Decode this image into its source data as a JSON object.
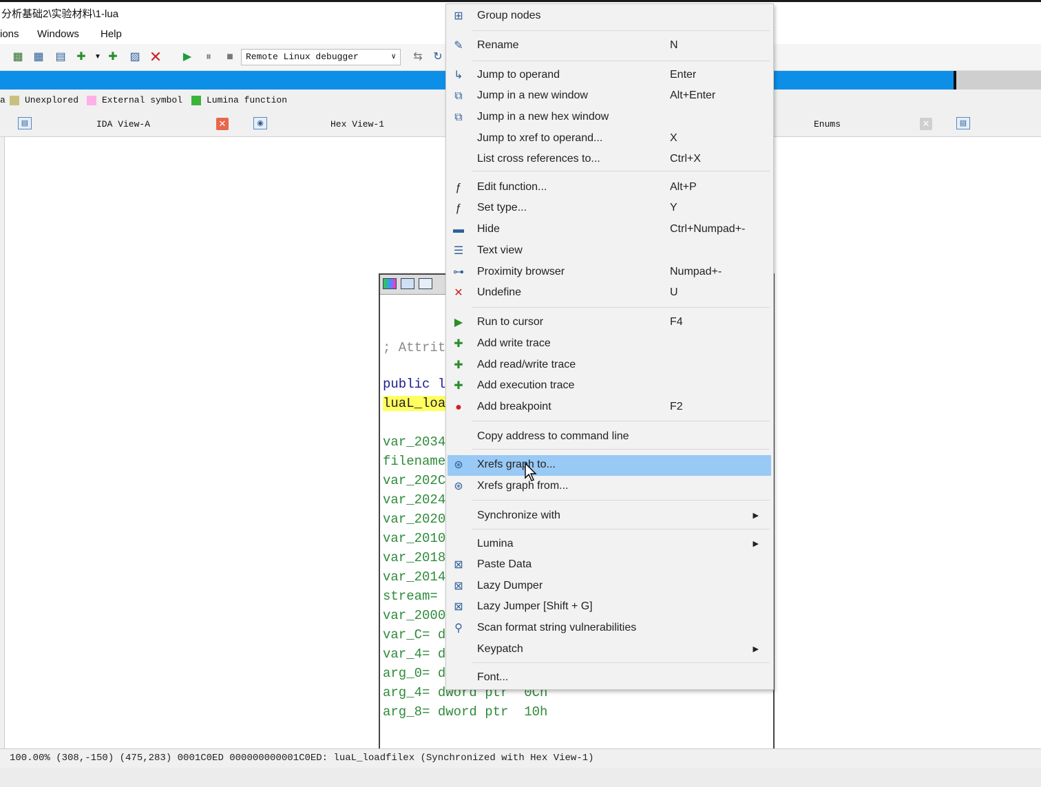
{
  "window": {
    "title": "分析基础2\\实验材料\\1-lua"
  },
  "menubar": {
    "items": [
      "ions",
      "Windows",
      "Help"
    ]
  },
  "toolbar": {
    "debugger": "Remote Linux debugger",
    "icons": [
      "new-seg-icon",
      "edit-seg-icon",
      "struct-icon",
      "bookmark-icon",
      "jump-icon",
      "rename-icon",
      "delete-icon",
      "play-icon",
      "pause-icon",
      "stop-icon",
      "debug-opt-icon",
      "refresh-icon"
    ]
  },
  "legend": {
    "items": [
      {
        "label": "Unexplored",
        "color": "#c8c080"
      },
      {
        "label": "External symbol",
        "color": "#ffb0e8"
      },
      {
        "label": "Lumina function",
        "color": "#3cb43c"
      }
    ],
    "prefix": "a"
  },
  "tabs": [
    {
      "label": "IDA View-A"
    },
    {
      "label": "Hex View-1"
    },
    {
      "label": "Enums"
    }
  ],
  "code": {
    "lines": [
      {
        "text": "; Attrit",
        "cls": "c-grey"
      },
      {
        "text": "public l",
        "cls": "c-navy"
      },
      {
        "text": "luaL_loa",
        "cls": "c-black hl"
      },
      {
        "text": "var_2034",
        "cls": "c-green"
      },
      {
        "text": "filename",
        "cls": "c-green"
      },
      {
        "text": "var_202C",
        "cls": "c-green"
      },
      {
        "text": "var_2024",
        "cls": "c-green"
      },
      {
        "text": "var_2020",
        "cls": "c-green"
      },
      {
        "text": "var_2010",
        "cls": "c-green"
      },
      {
        "text": "var_2018",
        "cls": "c-green"
      },
      {
        "text": "var_2014",
        "cls": "c-green"
      },
      {
        "text": "stream=",
        "cls": "c-green"
      },
      {
        "text": "var_2000",
        "cls": "c-green"
      },
      {
        "text": "var_C= d",
        "cls": "c-green"
      },
      {
        "text": "var_4= d",
        "cls": "c-green"
      },
      {
        "text": "arg_0= d",
        "cls": "c-green"
      },
      {
        "text": "arg_4= dword ptr  0Ch",
        "cls": "c-green"
      },
      {
        "text": "arg_8= dword ptr  10h",
        "cls": "c-green"
      }
    ]
  },
  "context_menu": {
    "items": [
      {
        "label": "Group nodes",
        "shortcut": "",
        "icon": "group-nodes-icon"
      },
      {
        "label": "Rename",
        "shortcut": "N",
        "icon": "rename-icon"
      },
      {
        "label": "Jump to operand",
        "shortcut": "Enter",
        "icon": "jump-operand-icon"
      },
      {
        "label": "Jump in a new window",
        "shortcut": "Alt+Enter",
        "icon": "new-window-icon"
      },
      {
        "label": "Jump in a new hex window",
        "shortcut": "",
        "icon": "hex-window-icon"
      },
      {
        "label": "Jump to xref to operand...",
        "shortcut": "X",
        "icon": ""
      },
      {
        "label": "List cross references to...",
        "shortcut": "Ctrl+X",
        "icon": ""
      },
      {
        "label": "Edit function...",
        "shortcut": "Alt+P",
        "icon": "function-icon"
      },
      {
        "label": "Set type...",
        "shortcut": "Y",
        "icon": "set-type-icon"
      },
      {
        "label": "Hide",
        "shortcut": "Ctrl+Numpad+-",
        "icon": "hide-icon"
      },
      {
        "label": "Text view",
        "shortcut": "",
        "icon": "text-view-icon"
      },
      {
        "label": "Proximity browser",
        "shortcut": "Numpad+-",
        "icon": "proximity-icon"
      },
      {
        "label": "Undefine",
        "shortcut": "U",
        "icon": "undefine-icon"
      },
      {
        "label": "Run to cursor",
        "shortcut": "F4",
        "icon": "run-cursor-icon"
      },
      {
        "label": "Add write trace",
        "shortcut": "",
        "icon": "write-trace-icon"
      },
      {
        "label": "Add read/write trace",
        "shortcut": "",
        "icon": "rw-trace-icon"
      },
      {
        "label": "Add execution trace",
        "shortcut": "",
        "icon": "exec-trace-icon"
      },
      {
        "label": "Add breakpoint",
        "shortcut": "F2",
        "icon": "breakpoint-icon"
      },
      {
        "label": "Copy address to command line",
        "shortcut": "",
        "icon": ""
      },
      {
        "label": "Xrefs graph to...",
        "shortcut": "",
        "icon": "xrefs-to-icon"
      },
      {
        "label": "Xrefs graph from...",
        "shortcut": "",
        "icon": "xrefs-from-icon"
      },
      {
        "label": "Synchronize with",
        "shortcut": "",
        "icon": ""
      },
      {
        "label": "Lumina",
        "shortcut": "",
        "icon": ""
      },
      {
        "label": "Paste Data",
        "shortcut": "",
        "icon": "plugin-icon"
      },
      {
        "label": "Lazy Dumper",
        "shortcut": "",
        "icon": "plugin-icon"
      },
      {
        "label": "Lazy Jumper [Shift + G]",
        "shortcut": "",
        "icon": "plugin-icon"
      },
      {
        "label": "Scan format string vulnerabilities",
        "shortcut": "",
        "icon": "magnifier-icon"
      },
      {
        "label": "Keypatch",
        "shortcut": "",
        "icon": ""
      },
      {
        "label": "Font...",
        "shortcut": "",
        "icon": ""
      }
    ],
    "selected": "Xrefs graph to...",
    "submenu_arrow": "▶"
  },
  "status": {
    "text": "100.00% (308,-150) (475,283) 0001C0ED 000000000001C0ED: luaL_loadfilex (Synchronized with Hex View-1)"
  },
  "colors": {
    "accent": "#0d8fe8",
    "selected": "#99c9f5",
    "code_green": "#2e8b3a"
  }
}
